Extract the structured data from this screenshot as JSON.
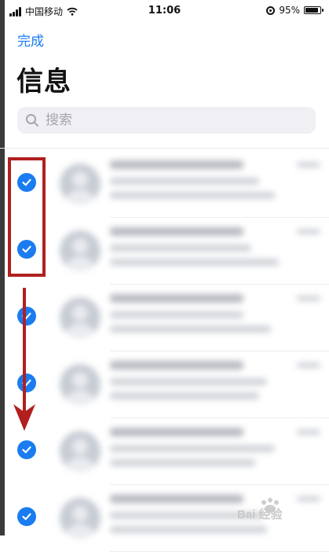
{
  "status_bar": {
    "carrier": "中国移动",
    "time": "11:06",
    "battery": "95%",
    "battery_level": 0.95,
    "icons": [
      "signal-icon",
      "wifi-icon",
      "orientation-lock-icon",
      "battery-icon"
    ]
  },
  "header": {
    "done_label": "完成",
    "title": "信息"
  },
  "search": {
    "placeholder": "搜索"
  },
  "messages": [
    {
      "selected": true
    },
    {
      "selected": true
    },
    {
      "selected": true
    },
    {
      "selected": true
    },
    {
      "selected": true
    },
    {
      "selected": true
    }
  ],
  "annotation": {
    "color": "#b0201f",
    "icons": [
      "selection-highlight-box",
      "arrow-down-icon"
    ]
  },
  "watermark": {
    "text": "Bai 经验",
    "icon": "baidu-paw-icon"
  },
  "colors": {
    "accent": "#1a7cf0",
    "annotation": "#b0201f"
  }
}
